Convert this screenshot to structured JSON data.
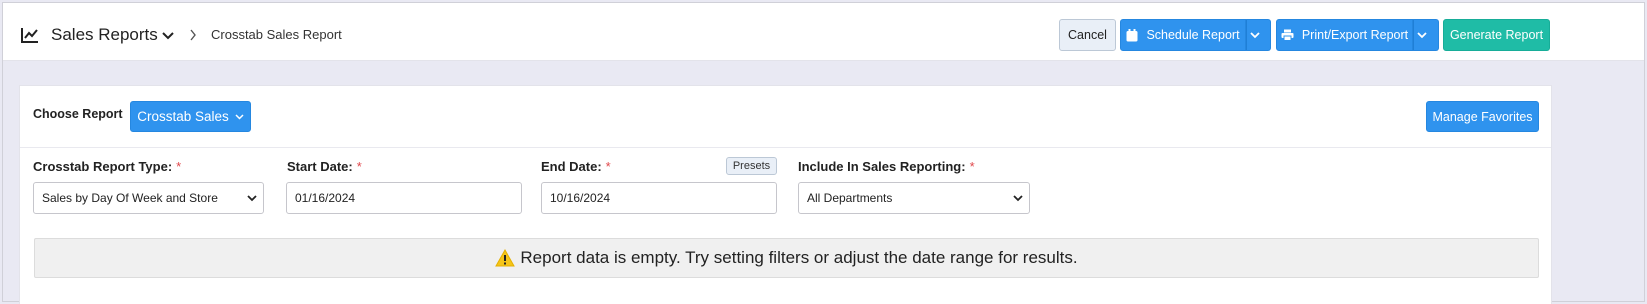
{
  "header": {
    "title": "Sales Reports",
    "breadcrumb": "Crosstab Sales Report",
    "icons": {
      "title_icon": "line-chart-icon",
      "caret": "chevron-down-icon",
      "separator": "chevron-right-icon"
    },
    "buttons": {
      "cancel": "Cancel",
      "schedule": "Schedule Report",
      "print_export": "Print/Export Report",
      "generate": "Generate Report"
    }
  },
  "panel": {
    "choose_report_label": "Choose Report",
    "report_selector": "Crosstab Sales",
    "manage_favorites": "Manage Favorites",
    "fields": {
      "report_type": {
        "label": "Crosstab Report Type:",
        "required": "*",
        "value": "Sales by Day Of Week and Store"
      },
      "start_date": {
        "label": "Start Date:",
        "required": "*",
        "value": "01/16/2024"
      },
      "end_date": {
        "label": "End Date:",
        "required": "*",
        "value": "10/16/2024",
        "presets": "Presets"
      },
      "include_sales": {
        "label": "Include In Sales Reporting:",
        "required": "*",
        "value": "All Departments"
      }
    },
    "alert": "Report data is empty. Try setting filters or adjust the date range for results."
  },
  "colors": {
    "primary": "#2f93ee",
    "teal": "#1fbca6",
    "required": "#e0464a",
    "warning": "#f5c518"
  }
}
